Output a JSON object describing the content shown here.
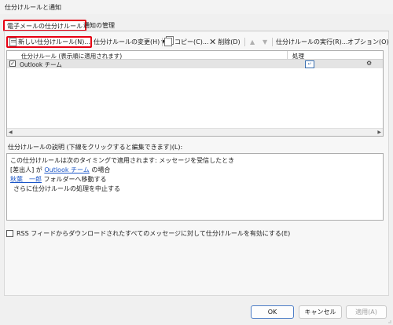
{
  "window": {
    "title": "仕分けルールと通知"
  },
  "tabs": [
    {
      "label": "電子メールの仕分けルール"
    },
    {
      "label": "通知の管理"
    }
  ],
  "toolbar": {
    "new_rule": "新しい仕分けルール(N)...",
    "change_rule": "仕分けルールの変更(H)",
    "copy": "コピー(C)...",
    "delete": "削除(D)",
    "run_rules": "仕分けルールの実行(R)...",
    "options": "オプション(O)"
  },
  "rules_table": {
    "headers": {
      "name": "仕分けルール (表示順に適用されます)",
      "action": "処理"
    },
    "rows": [
      {
        "checked": true,
        "name": "Outlook チーム"
      }
    ]
  },
  "description": {
    "label": "仕分けルールの説明 (下線をクリックすると編集できます)(L):",
    "line1": "この仕分けルールは次のタイミングで適用されます: メッセージを受信したとき",
    "line2_pre": "[差出人] が ",
    "line2_link": "Outlook チーム",
    "line2_post": " の場合",
    "line3_link": "秋葉　一郎",
    "line3_post": " フォルダーへ移動する",
    "line4": "さらに仕分けルールの処理を中止する"
  },
  "rss_option": {
    "label": "RSS フィードからダウンロードされたすべてのメッセージに対して仕分けルールを有効にする(E)",
    "checked": false
  },
  "buttons": {
    "ok": "OK",
    "cancel": "キャンセル",
    "apply": "適用(A)"
  }
}
